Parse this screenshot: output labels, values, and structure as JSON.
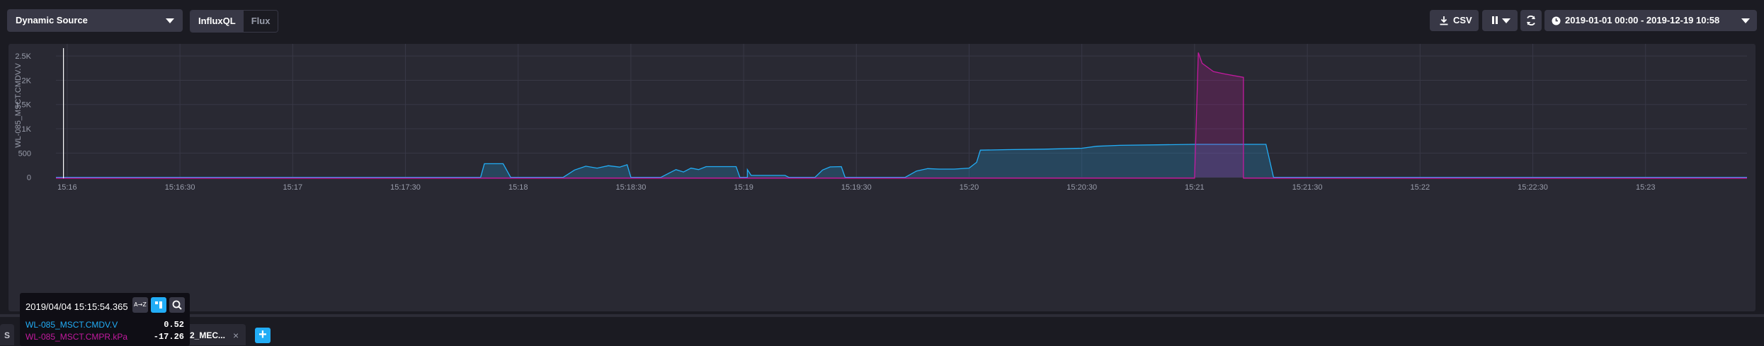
{
  "toolbar": {
    "source_label": "Dynamic Source",
    "languages": [
      "InfluxQL",
      "Flux"
    ],
    "active_language": "InfluxQL",
    "csv_label": "CSV",
    "time_range": "2019-01-01 00:00 - 2019-12-19 10:58"
  },
  "tooltip": {
    "timestamp": "2019/04/04 15:15:54.365",
    "sort_alpha_icon": "A→Z",
    "sort_value_icon": "sort-by-value",
    "rows": [
      {
        "name": "WL-085_MSCT.CMDV.V",
        "value": "0.52",
        "color": "#22adf6"
      },
      {
        "name": "WL-085_MSCT.CMPR.kPa",
        "value": "-17.26",
        "color": "#c31a9f"
      }
    ]
  },
  "tabs": {
    "tab1_label": "S",
    "tab2_label": "2_MEC...",
    "close_glyph": "×",
    "add_glyph": "+"
  },
  "colors": {
    "series1": "#22adf6",
    "series2": "#c31a9f",
    "accent": "#22adf6"
  },
  "chart_data": {
    "type": "line",
    "ylabel": "WL-085_MSCT.CMDV.V",
    "xlabel": "",
    "ylim": [
      -20,
      2750
    ],
    "y_ticks": [
      0,
      500,
      1000,
      1500,
      2000,
      2500
    ],
    "y_tick_labels": [
      "0",
      "500",
      "1K",
      "1.5K",
      "2K",
      "2.5K"
    ],
    "x_range": [
      "15:15:57",
      "15:23:27"
    ],
    "x_ticks": [
      "15:16",
      "15:16:30",
      "15:17",
      "15:17:30",
      "15:18",
      "15:18:30",
      "15:19",
      "15:19:30",
      "15:20",
      "15:20:30",
      "15:21",
      "15:21:30",
      "15:22",
      "15:22:30",
      "15:23"
    ],
    "cursor_time": "15:15:59",
    "grid": true,
    "fill": true,
    "series": [
      {
        "name": "WL-085_MSCT.CMDV.V",
        "points": [
          [
            "15:15:57",
            0
          ],
          [
            "15:17:50",
            0
          ],
          [
            "15:17:51",
            280
          ],
          [
            "15:17:56",
            280
          ],
          [
            "15:17:58",
            0
          ],
          [
            "15:18:12",
            0
          ],
          [
            "15:18:15",
            150
          ],
          [
            "15:18:18",
            230
          ],
          [
            "15:18:21",
            190
          ],
          [
            "15:18:24",
            240
          ],
          [
            "15:18:27",
            210
          ],
          [
            "15:18:29",
            260
          ],
          [
            "15:18:30",
            0
          ],
          [
            "15:18:38",
            0
          ],
          [
            "15:18:40",
            80
          ],
          [
            "15:18:42",
            160
          ],
          [
            "15:18:44",
            110
          ],
          [
            "15:18:46",
            190
          ],
          [
            "15:18:48",
            160
          ],
          [
            "15:18:50",
            220
          ],
          [
            "15:18:58",
            220
          ],
          [
            "15:18:59",
            0
          ],
          [
            "15:19:01",
            0
          ],
          [
            "15:19:01",
            160
          ],
          [
            "15:19:02",
            40
          ],
          [
            "15:19:11",
            40
          ],
          [
            "15:19:12",
            0
          ],
          [
            "15:19:19",
            0
          ],
          [
            "15:19:21",
            150
          ],
          [
            "15:19:23",
            215
          ],
          [
            "15:19:26",
            220
          ],
          [
            "15:19:27",
            0
          ],
          [
            "15:19:43",
            0
          ],
          [
            "15:19:46",
            130
          ],
          [
            "15:19:49",
            180
          ],
          [
            "15:19:52",
            170
          ],
          [
            "15:19:56",
            170
          ],
          [
            "15:20:00",
            190
          ],
          [
            "15:20:02",
            310
          ],
          [
            "15:20:03",
            560
          ],
          [
            "15:20:10",
            570
          ],
          [
            "15:20:20",
            580
          ],
          [
            "15:20:30",
            600
          ],
          [
            "15:20:34",
            640
          ],
          [
            "15:20:40",
            660
          ],
          [
            "15:20:50",
            670
          ],
          [
            "15:21:00",
            680
          ],
          [
            "15:21:19",
            680
          ],
          [
            "15:21:21",
            0
          ],
          [
            "15:23:27",
            0
          ]
        ]
      },
      {
        "name": "WL-085_MSCT.CMPR.kPa",
        "points": [
          [
            "15:15:57",
            -17
          ],
          [
            "15:21:00",
            -17
          ],
          [
            "15:21:01",
            2570
          ],
          [
            "15:21:02",
            2350
          ],
          [
            "15:21:05",
            2180
          ],
          [
            "15:21:08",
            2130
          ],
          [
            "15:21:13",
            2060
          ],
          [
            "15:21:13",
            -17
          ],
          [
            "15:23:27",
            -17
          ]
        ]
      }
    ]
  }
}
